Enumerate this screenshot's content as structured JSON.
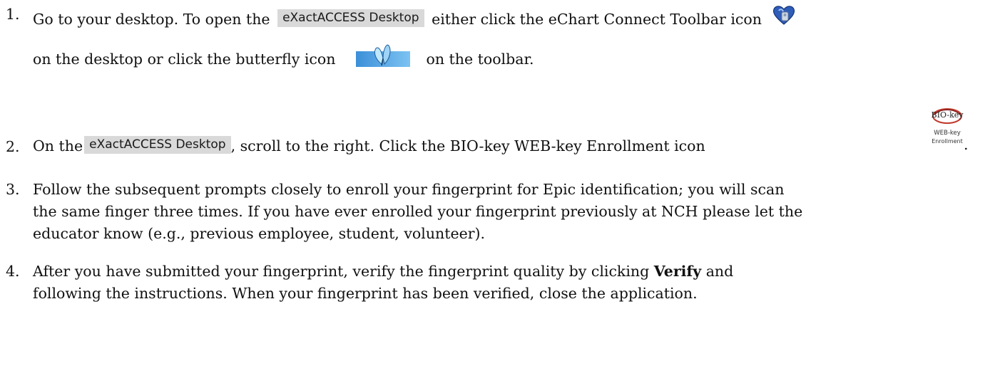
{
  "steps": [
    {
      "number": "1.",
      "text_a": "Go to your desktop. To open the",
      "chip": "eXactACCESS Desktop",
      "text_b": "either click the eChart Connect Toolbar icon",
      "text_c": "on the desktop or click the butterfly icon",
      "text_d": "on the toolbar."
    },
    {
      "number": "2.",
      "text_a": "On the",
      "chip": "eXactACCESS Desktop",
      "text_b": ", scroll to the right. Click the BIO-key WEB-key Enrollment icon",
      "text_c": ".",
      "icon_top": "BIO-key",
      "icon_mid": "WEB-key",
      "icon_bottom": "Enrollment"
    },
    {
      "number": "3.",
      "line1": "Follow the subsequent prompts closely to enroll your fingerprint for Epic identification; you will scan",
      "line2": "the same finger three times. If you have ever enrolled your fingerprint previously at NCH please let the",
      "line3": "educator know (e.g., previous employee, student, volunteer)."
    },
    {
      "number": "4.",
      "line1_a": "After you have submitted your fingerprint, verify the fingerprint quality by clicking",
      "line1_bold": "Verify",
      "line1_b": "and",
      "line2": "following the instructions. When your fingerprint has been verified, close the application."
    }
  ],
  "icons": {
    "echart": "echart-connect-toolbar-icon",
    "butterfly": "butterfly-icon",
    "biokey": "bio-key-web-key-enrollment-icon"
  }
}
